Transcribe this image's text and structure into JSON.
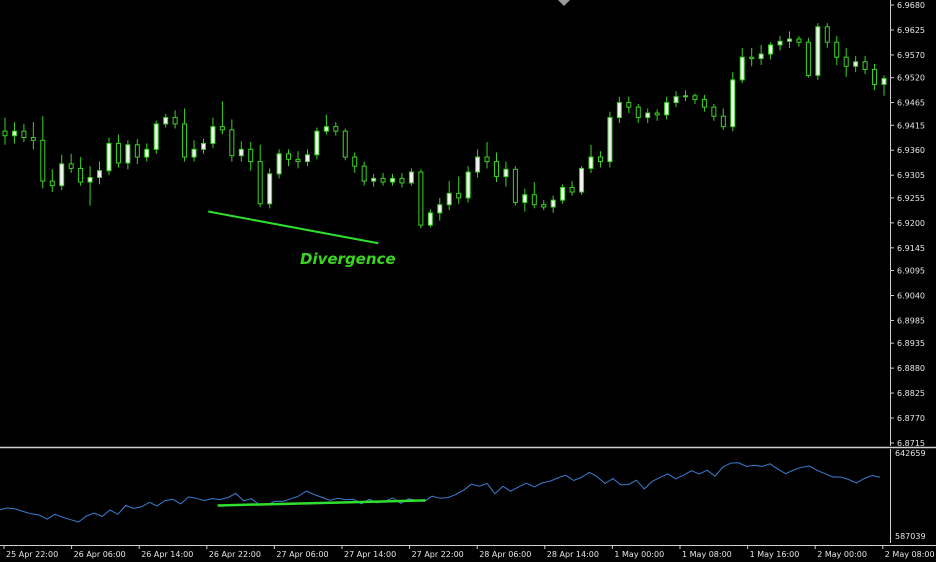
{
  "colors": {
    "background": "#000000",
    "bull_fill": "#f2f2f2",
    "bear_fill": "#000000",
    "candle_outline": "#39d51f",
    "indicator_line": "#3a7fd0",
    "trendline": "#2fdf2f",
    "axis_text": "#e6e6e6",
    "axis_line": "#cfcfcf"
  },
  "chart_data": [
    {
      "type": "candlestick",
      "price_axis": {
        "ylim": [
          6.8715,
          6.968
        ],
        "ticks": [
          "6.9680",
          "6.9625",
          "6.9570",
          "6.9520",
          "6.9465",
          "6.9415",
          "6.9360",
          "6.9305",
          "6.9255",
          "6.9200",
          "6.9145",
          "6.9095",
          "6.9040",
          "6.8985",
          "6.8935",
          "6.8880",
          "6.8825",
          "6.8770",
          "6.8715"
        ]
      },
      "annotation": {
        "text": "Divergence"
      },
      "trendline": {
        "x": [
          21.5,
          39.5
        ],
        "y": [
          6.9225,
          6.9155
        ]
      },
      "candles": [
        {
          "o": 6.9402,
          "h": 6.9432,
          "l": 6.9372,
          "c": 6.9392
        },
        {
          "o": 6.9392,
          "h": 6.9422,
          "l": 6.9375,
          "c": 6.9402
        },
        {
          "o": 6.9402,
          "h": 6.9418,
          "l": 6.9378,
          "c": 6.9388
        },
        {
          "o": 6.9388,
          "h": 6.9422,
          "l": 6.9362,
          "c": 6.9382
        },
        {
          "o": 6.9382,
          "h": 6.9435,
          "l": 6.9276,
          "c": 6.9292
        },
        {
          "o": 6.9292,
          "h": 6.9318,
          "l": 6.9268,
          "c": 6.9282
        },
        {
          "o": 6.9282,
          "h": 6.935,
          "l": 6.9272,
          "c": 6.933
        },
        {
          "o": 6.933,
          "h": 6.9352,
          "l": 6.931,
          "c": 6.932
        },
        {
          "o": 6.932,
          "h": 6.9345,
          "l": 6.9282,
          "c": 6.929
        },
        {
          "o": 6.929,
          "h": 6.9325,
          "l": 6.9238,
          "c": 6.93
        },
        {
          "o": 6.93,
          "h": 6.9335,
          "l": 6.9285,
          "c": 6.9315
        },
        {
          "o": 6.9315,
          "h": 6.9388,
          "l": 6.9305,
          "c": 6.9375
        },
        {
          "o": 6.9375,
          "h": 6.9395,
          "l": 6.9322,
          "c": 6.9332
        },
        {
          "o": 6.9332,
          "h": 6.9382,
          "l": 6.9318,
          "c": 6.9372
        },
        {
          "o": 6.9372,
          "h": 6.9385,
          "l": 6.933,
          "c": 6.9345
        },
        {
          "o": 6.9345,
          "h": 6.9375,
          "l": 6.9335,
          "c": 6.9362
        },
        {
          "o": 6.9362,
          "h": 6.9425,
          "l": 6.9352,
          "c": 6.9418
        },
        {
          "o": 6.9418,
          "h": 6.944,
          "l": 6.941,
          "c": 6.9432
        },
        {
          "o": 6.9432,
          "h": 6.9448,
          "l": 6.9408,
          "c": 6.9418
        },
        {
          "o": 6.9418,
          "h": 6.9452,
          "l": 6.9335,
          "c": 6.9345
        },
        {
          "o": 6.9345,
          "h": 6.9382,
          "l": 6.9335,
          "c": 6.9362
        },
        {
          "o": 6.9362,
          "h": 6.9385,
          "l": 6.9352,
          "c": 6.9375
        },
        {
          "o": 6.9375,
          "h": 6.9432,
          "l": 6.9365,
          "c": 6.9412
        },
        {
          "o": 6.9412,
          "h": 6.9468,
          "l": 6.9395,
          "c": 6.9405
        },
        {
          "o": 6.9405,
          "h": 6.9428,
          "l": 6.9335,
          "c": 6.9348
        },
        {
          "o": 6.9348,
          "h": 6.938,
          "l": 6.9335,
          "c": 6.9362
        },
        {
          "o": 6.9362,
          "h": 6.9378,
          "l": 6.9315,
          "c": 6.9335
        },
        {
          "o": 6.9335,
          "h": 6.9372,
          "l": 6.9235,
          "c": 6.9242
        },
        {
          "o": 6.9242,
          "h": 6.932,
          "l": 6.9232,
          "c": 6.9308
        },
        {
          "o": 6.9308,
          "h": 6.9362,
          "l": 6.9298,
          "c": 6.9352
        },
        {
          "o": 6.9352,
          "h": 6.9362,
          "l": 6.9325,
          "c": 6.934
        },
        {
          "o": 6.934,
          "h": 6.9358,
          "l": 6.932,
          "c": 6.9335
        },
        {
          "o": 6.9335,
          "h": 6.9362,
          "l": 6.9325,
          "c": 6.935
        },
        {
          "o": 6.935,
          "h": 6.941,
          "l": 6.934,
          "c": 6.9402
        },
        {
          "o": 6.9402,
          "h": 6.9438,
          "l": 6.9395,
          "c": 6.9412
        },
        {
          "o": 6.9412,
          "h": 6.9422,
          "l": 6.9392,
          "c": 6.9402
        },
        {
          "o": 6.9402,
          "h": 6.9408,
          "l": 6.9338,
          "c": 6.9345
        },
        {
          "o": 6.9345,
          "h": 6.9355,
          "l": 6.931,
          "c": 6.9325
        },
        {
          "o": 6.9325,
          "h": 6.9335,
          "l": 6.9282,
          "c": 6.9292
        },
        {
          "o": 6.9292,
          "h": 6.9308,
          "l": 6.928,
          "c": 6.9298
        },
        {
          "o": 6.9298,
          "h": 6.931,
          "l": 6.9282,
          "c": 6.929
        },
        {
          "o": 6.929,
          "h": 6.9308,
          "l": 6.9282,
          "c": 6.9298
        },
        {
          "o": 6.9298,
          "h": 6.931,
          "l": 6.9278,
          "c": 6.9288
        },
        {
          "o": 6.9288,
          "h": 6.932,
          "l": 6.9282,
          "c": 6.9312
        },
        {
          "o": 6.9312,
          "h": 6.9318,
          "l": 6.9188,
          "c": 6.9195
        },
        {
          "o": 6.9195,
          "h": 6.923,
          "l": 6.919,
          "c": 6.9222
        },
        {
          "o": 6.9222,
          "h": 6.9255,
          "l": 6.9205,
          "c": 6.924
        },
        {
          "o": 6.924,
          "h": 6.9292,
          "l": 6.9228,
          "c": 6.9265
        },
        {
          "o": 6.9265,
          "h": 6.9302,
          "l": 6.9242,
          "c": 6.9255
        },
        {
          "o": 6.9255,
          "h": 6.9325,
          "l": 6.9245,
          "c": 6.9312
        },
        {
          "o": 6.9312,
          "h": 6.9362,
          "l": 6.93,
          "c": 6.9345
        },
        {
          "o": 6.9345,
          "h": 6.9378,
          "l": 6.932,
          "c": 6.9335
        },
        {
          "o": 6.9335,
          "h": 6.9355,
          "l": 6.929,
          "c": 6.9302
        },
        {
          "o": 6.9302,
          "h": 6.9335,
          "l": 6.928,
          "c": 6.9318
        },
        {
          "o": 6.9318,
          "h": 6.9325,
          "l": 6.9238,
          "c": 6.9245
        },
        {
          "o": 6.9245,
          "h": 6.9275,
          "l": 6.9225,
          "c": 6.9262
        },
        {
          "o": 6.9262,
          "h": 6.929,
          "l": 6.9232,
          "c": 6.924
        },
        {
          "o": 6.924,
          "h": 6.925,
          "l": 6.9228,
          "c": 6.9235
        },
        {
          "o": 6.9235,
          "h": 6.926,
          "l": 6.9222,
          "c": 6.925
        },
        {
          "o": 6.925,
          "h": 6.9285,
          "l": 6.9242,
          "c": 6.9278
        },
        {
          "o": 6.9278,
          "h": 6.9292,
          "l": 6.926,
          "c": 6.9268
        },
        {
          "o": 6.9268,
          "h": 6.9325,
          "l": 6.9262,
          "c": 6.932
        },
        {
          "o": 6.932,
          "h": 6.9372,
          "l": 6.931,
          "c": 6.9345
        },
        {
          "o": 6.9345,
          "h": 6.9358,
          "l": 6.9322,
          "c": 6.9335
        },
        {
          "o": 6.9335,
          "h": 6.9445,
          "l": 6.9322,
          "c": 6.9432
        },
        {
          "o": 6.9432,
          "h": 6.9478,
          "l": 6.942,
          "c": 6.9465
        },
        {
          "o": 6.9465,
          "h": 6.9478,
          "l": 6.9442,
          "c": 6.9455
        },
        {
          "o": 6.9455,
          "h": 6.9462,
          "l": 6.942,
          "c": 6.9432
        },
        {
          "o": 6.9432,
          "h": 6.9452,
          "l": 6.942,
          "c": 6.9442
        },
        {
          "o": 6.9442,
          "h": 6.945,
          "l": 6.9425,
          "c": 6.9438
        },
        {
          "o": 6.9438,
          "h": 6.9478,
          "l": 6.9428,
          "c": 6.9465
        },
        {
          "o": 6.9465,
          "h": 6.949,
          "l": 6.9455,
          "c": 6.9478
        },
        {
          "o": 6.9478,
          "h": 6.9492,
          "l": 6.9468,
          "c": 6.948
        },
        {
          "o": 6.948,
          "h": 6.9485,
          "l": 6.9462,
          "c": 6.9472
        },
        {
          "o": 6.9472,
          "h": 6.9482,
          "l": 6.9445,
          "c": 6.9455
        },
        {
          "o": 6.9455,
          "h": 6.9462,
          "l": 6.9425,
          "c": 6.9435
        },
        {
          "o": 6.9435,
          "h": 6.9452,
          "l": 6.9405,
          "c": 6.9412
        },
        {
          "o": 6.9412,
          "h": 6.9532,
          "l": 6.9402,
          "c": 6.9515
        },
        {
          "o": 6.9515,
          "h": 6.9585,
          "l": 6.9508,
          "c": 6.9565
        },
        {
          "o": 6.9565,
          "h": 6.9585,
          "l": 6.9545,
          "c": 6.9562
        },
        {
          "o": 6.9562,
          "h": 6.9592,
          "l": 6.9548,
          "c": 6.9572
        },
        {
          "o": 6.9572,
          "h": 6.9598,
          "l": 6.956,
          "c": 6.9592
        },
        {
          "o": 6.9592,
          "h": 6.9612,
          "l": 6.958,
          "c": 6.96
        },
        {
          "o": 6.96,
          "h": 6.9622,
          "l": 6.9585,
          "c": 6.9605
        },
        {
          "o": 6.9605,
          "h": 6.9612,
          "l": 6.9588,
          "c": 6.9598
        },
        {
          "o": 6.9598,
          "h": 6.9608,
          "l": 6.952,
          "c": 6.9525
        },
        {
          "o": 6.9525,
          "h": 6.964,
          "l": 6.9515,
          "c": 6.9632
        },
        {
          "o": 6.9632,
          "h": 6.964,
          "l": 6.9585,
          "c": 6.9598
        },
        {
          "o": 6.9598,
          "h": 6.9612,
          "l": 6.9548,
          "c": 6.9565
        },
        {
          "o": 6.9565,
          "h": 6.9585,
          "l": 6.9522,
          "c": 6.9545
        },
        {
          "o": 6.9545,
          "h": 6.9568,
          "l": 6.9532,
          "c": 6.9555
        },
        {
          "o": 6.9555,
          "h": 6.9568,
          "l": 6.9528,
          "c": 6.9538
        },
        {
          "o": 6.9538,
          "h": 6.955,
          "l": 6.9492,
          "c": 6.9505
        },
        {
          "o": 6.9505,
          "h": 6.9525,
          "l": 6.948,
          "c": 6.9518
        }
      ]
    },
    {
      "type": "line",
      "name": "indicator",
      "axis": {
        "top_label": "642659",
        "bottom_label": "587039",
        "ylim": [
          587039,
          642659
        ]
      },
      "trendline": {
        "x": [
          22.5,
          44.5
        ],
        "y": [
          609500,
          612500
        ]
      },
      "values": [
        607000,
        608000,
        607400,
        605800,
        604500,
        603800,
        601300,
        604200,
        602400,
        601000,
        599600,
        603200,
        605000,
        602900,
        606800,
        604200,
        609500,
        607700,
        608600,
        611400,
        609200,
        612400,
        613200,
        610400,
        614600,
        613800,
        612400,
        613600,
        613000,
        614200,
        616700,
        612300,
        613500,
        610000,
        609900,
        612000,
        611900,
        613500,
        615100,
        618100,
        616000,
        614300,
        612600,
        613800,
        612900,
        613200,
        610500,
        613200,
        611000,
        612000,
        614000,
        610800,
        613400,
        612600,
        612000,
        615000,
        613800,
        614200,
        616000,
        618600,
        622200,
        621000,
        622600,
        616500,
        621000,
        618000,
        620600,
        622800,
        620600,
        623000,
        624000,
        626000,
        627600,
        624400,
        626300,
        629300,
        626700,
        622600,
        625600,
        621800,
        622000,
        624600,
        619400,
        623900,
        626300,
        628400,
        625400,
        627600,
        630300,
        628300,
        630600,
        627000,
        632500,
        634800,
        635000,
        632800,
        633500,
        632800,
        634400,
        631200,
        628500,
        630700,
        632300,
        633100,
        630500,
        628500,
        626500,
        626500,
        625000,
        623000,
        625600,
        627400,
        626400
      ]
    },
    {
      "type": "time-axis",
      "labels": [
        "25 Apr 22:00",
        "26 Apr 06:00",
        "26 Apr 14:00",
        "26 Apr 22:00",
        "27 Apr 06:00",
        "27 Apr 14:00",
        "27 Apr 22:00",
        "28 Apr 06:00",
        "28 Apr 14:00",
        "1 May 00:00",
        "1 May 08:00",
        "1 May 16:00",
        "2 May 00:00",
        "2 May 08:00"
      ]
    }
  ]
}
